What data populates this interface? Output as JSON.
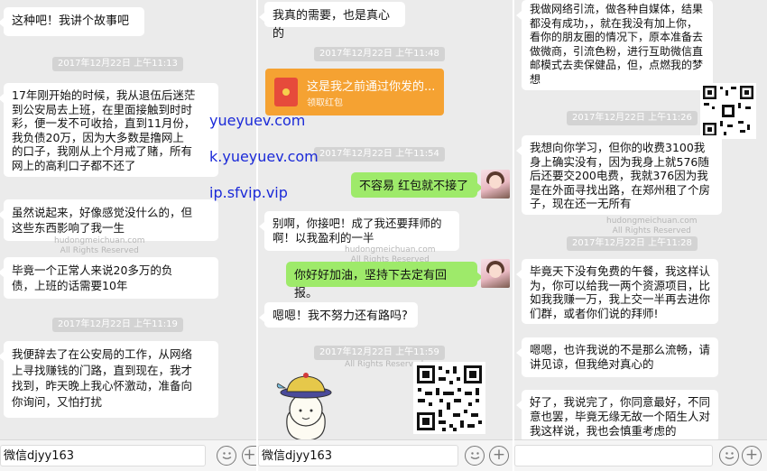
{
  "colors": {
    "bubble_white": "#ffffff",
    "bubble_green": "#9eea6a",
    "bg": "#ebebeb",
    "red_packet": "#f5a232",
    "overlay_text": "#1b2ad8"
  },
  "watermark": {
    "site": "hudongmeichuan.com",
    "rights": "All Rights Reserved"
  },
  "overlay_links": [
    "yueyuev.com",
    "k.yueyuev.com",
    "ip.sfvip.vip"
  ],
  "col1": {
    "messages": [
      "这种吧！我讲个故事吧",
      "17年刚开始的时候，我从退伍后迷茫\n到公安局去上班，在里面接触到时时\n彩，便一发不可收拾，直到11月份，\n我负债20万，因为大多数是撸网上\n的口子，我刚从上个月戒了赌，所有\n网上的高利口子都不还了",
      "虽然说起来，好像感觉没什么的，但\n这些东西影响了我一生",
      "毕竟一个正常人来说20多万的负\n债，上班的话需要10年",
      "我便辞去了在公安局的工作，从网络\n上寻找赚钱的门路，直到现在，我才\n找到，昨天晚上我心怀激动，准备向\n你询问，又怕打扰"
    ],
    "timestamps": [
      "2017年12月22日 上午11:13",
      "2017年12月22日 上午11:19"
    ],
    "input_value": "微信djyy163"
  },
  "col2": {
    "messages_left": [
      "我真的需要，也是真心的",
      "别啊，你接吧！成了我还要拜师的\n啊！以我盈利的一半",
      "嗯嗯！我不努力还有路吗?"
    ],
    "messages_right": [
      "不容易 红包就不接了",
      "你好好加油，坚持下去定有回报。"
    ],
    "timestamps": [
      "2017年12月22日 上午11:48",
      "2017年12月22日 上午11:54",
      "2017年12月22日 上午11:59"
    ],
    "red_packet": {
      "title": "这是我之前通过你发的...",
      "subtitle": "领取红包"
    },
    "input_value": "微信djyy163"
  },
  "col3": {
    "messages": [
      "我做网络引流，做各种自媒体，结果\n都没有成功，，就在我没有加上你，\n看你的朋友圈的情况下，原本准备去\n做微商，引流色粉，进行互助微信直\n邮模式去卖保健品，但，点燃我的梦\n想",
      "我想向你学习，但你的收费3100我\n身上确实没有，因为我身上就576随\n后还要交200电费，我就376因为我\n是在外面寻找出路，在郑州租了个房\n子，现在还一无所有",
      "毕竟天下没有免费的午餐，我这样认\n为，你可以给我一两个资源项目，比\n如我我赚一万，我上交一半再去进你\n们群，或者你们说的拜师!",
      "嗯嗯，也许我说的不是那么流畅，请\n讲见谅，但我绝对真心的",
      "好了，我说完了，你同意最好，不同\n意也罢，毕竟无缘无故一个陌生人对\n我这样说，我也会慎重考虑的"
    ],
    "timestamps": [
      "2017年12月22日 上午11:26",
      "2017年12月22日 上午11:28"
    ]
  },
  "icons": {
    "emoji": "emoji-icon",
    "plus": "plus-icon",
    "plus_symbol": "+"
  }
}
